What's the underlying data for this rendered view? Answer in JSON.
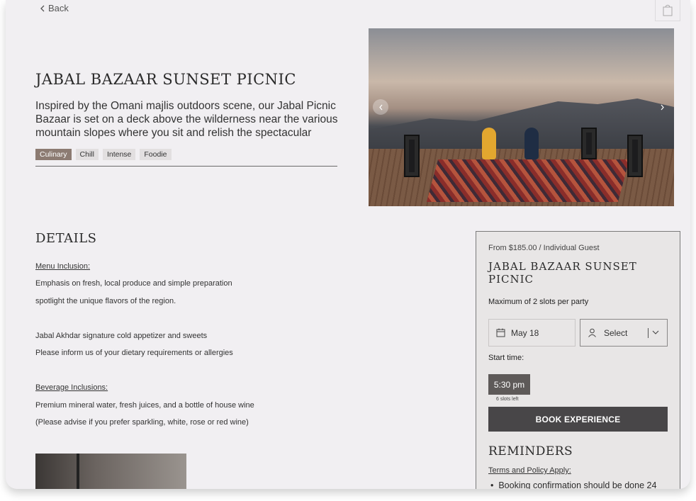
{
  "nav": {
    "back_label": "Back"
  },
  "experience": {
    "title": "JABAL BAZAAR SUNSET PICNIC",
    "description": "Inspired by the Omani majlis outdoors scene, our Jabal Picnic Bazaar is set on a deck above the wilderness near the various mountain slopes where you sit and relish the spectacular",
    "tags": [
      "Culinary",
      "Chill",
      "Intense",
      "Foodie"
    ],
    "active_tag": "Culinary"
  },
  "details": {
    "heading": "DETAILS",
    "menu_heading": "Menu Inclusion:",
    "menu_lines": [
      "Emphasis on fresh, local produce and simple preparation",
      "spotlight the unique flavors of the region.",
      "Jabal Akhdar signature cold appetizer and sweets",
      "Please inform us of your dietary requirements or allergies"
    ],
    "beverage_heading": "Beverage Inclusions:",
    "beverage_lines": [
      "Premium mineral water, fresh juices, and a bottle of house wine",
      "(Please advise if you prefer sparkling, white, rose or red wine)"
    ]
  },
  "booking": {
    "price": "From $185.00 / Individual Guest",
    "title": "JABAL BAZAAR SUNSET PICNIC",
    "max_slots": "Maximum of 2 slots per party",
    "date": "May 18",
    "guest_select": "Select",
    "start_time_label": "Start time:",
    "time_slot": "5:30 pm",
    "slots_left": "6 slots left",
    "book_button": "BOOK EXPERIENCE",
    "reminders_heading": "REMINDERS",
    "terms_link": "Terms and Policy Apply:",
    "reminder_1": "Booking confirmation should be done 24"
  },
  "icons": {
    "back": "chevron-left-icon",
    "cart": "shopping-bag-icon",
    "calendar": "calendar-icon",
    "guest": "user-icon",
    "dropdown": "chevron-down-icon",
    "gallery_prev": "chevron-left-icon",
    "gallery_next": "chevron-right-icon"
  },
  "colors": {
    "page_bg": "#f1eff2",
    "active_tag": "#8c7b72",
    "book_button": "#484648",
    "time_slot": "#5e5a59"
  }
}
